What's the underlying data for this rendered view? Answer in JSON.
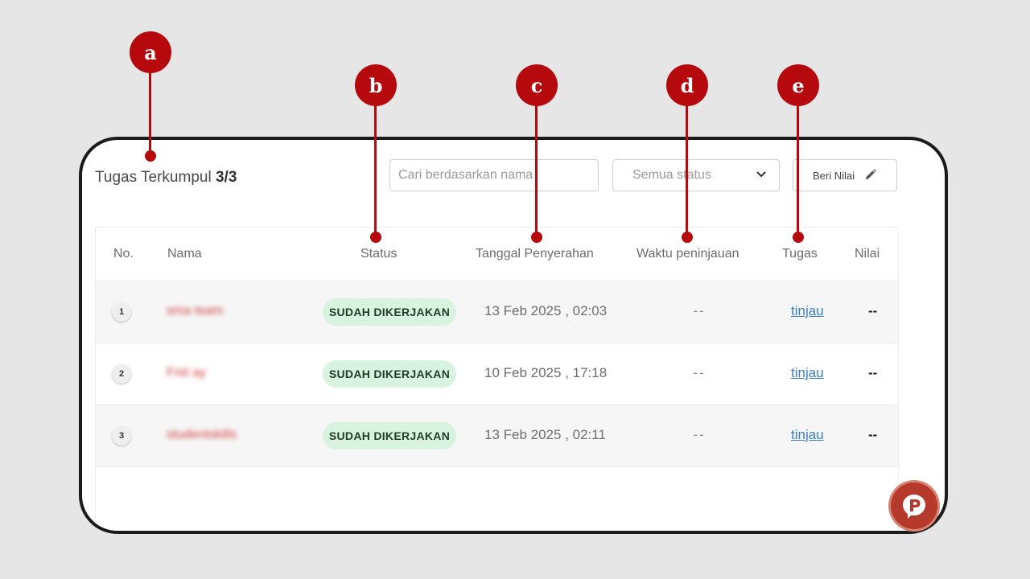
{
  "header": {
    "title_prefix": "Tugas Terkumpul",
    "count": "3/3"
  },
  "search": {
    "placeholder": "Cari berdasarkan nama"
  },
  "status_filter": {
    "selected": "Semua status"
  },
  "grade_button": {
    "label": "Beri Nilai"
  },
  "table": {
    "headers": {
      "no": "No.",
      "name": "Nama",
      "status": "Status",
      "submitted": "Tanggal Penyerahan",
      "review_time": "Waktu peninjauan",
      "task": "Tugas",
      "grade": "Nilai"
    },
    "rows": [
      {
        "no": "1",
        "name": "sma team",
        "status": "SUDAH DIKERJAKAN",
        "submitted": "13 Feb 2025 , 02:03",
        "review_time": "--",
        "task": "tinjau",
        "grade": "--"
      },
      {
        "no": "2",
        "name": "Frid ay",
        "status": "SUDAH DIKERJAKAN",
        "submitted": "10 Feb 2025 , 17:18",
        "review_time": "--",
        "task": "tinjau",
        "grade": "--"
      },
      {
        "no": "3",
        "name": "studentskills",
        "status": "SUDAH DIKERJAKAN",
        "submitted": "13 Feb 2025 , 02:11",
        "review_time": "--",
        "task": "tinjau",
        "grade": "--"
      }
    ]
  },
  "callouts": [
    "a",
    "b",
    "c",
    "d",
    "e"
  ],
  "colors": {
    "callout": "#b5090e",
    "badge_bg": "#d8f3df",
    "link": "#3b7ec2"
  },
  "icons": {
    "dropdown": "chevron-down-icon",
    "edit": "pencil-icon",
    "brand": "brand-logo-icon"
  }
}
